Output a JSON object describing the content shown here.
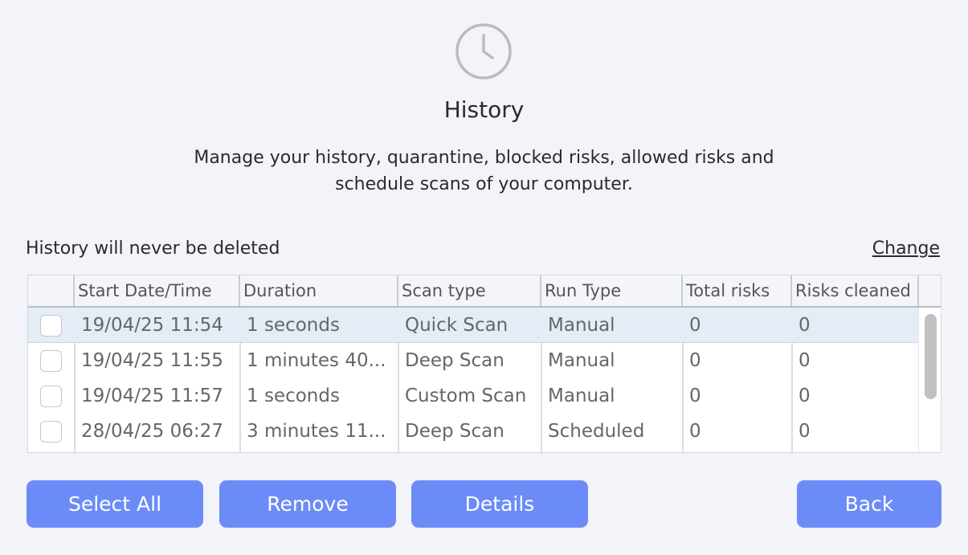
{
  "header": {
    "icon": "clock-icon",
    "title": "History",
    "subtitle_line1": "Manage your history, quarantine, blocked risks, allowed risks and",
    "subtitle_line2": "schedule scans of your computer."
  },
  "retention": {
    "label": "History will never be deleted",
    "change_link": "Change"
  },
  "table": {
    "columns": [
      "Start Date/Time",
      "Duration",
      "Scan type",
      "Run Type",
      "Total risks",
      "Risks cleaned"
    ],
    "rows": [
      {
        "start": "19/04/25 11:54",
        "duration": "1 seconds",
        "scan_type": "Quick Scan",
        "run_type": "Manual",
        "total_risks": "0",
        "risks_cleaned": "0",
        "selected": true
      },
      {
        "start": "19/04/25 11:55",
        "duration": "1 minutes 40...",
        "scan_type": "Deep Scan",
        "run_type": "Manual",
        "total_risks": "0",
        "risks_cleaned": "0",
        "selected": false
      },
      {
        "start": "19/04/25 11:57",
        "duration": "1 seconds",
        "scan_type": "Custom Scan",
        "run_type": "Manual",
        "total_risks": "0",
        "risks_cleaned": "0",
        "selected": false
      },
      {
        "start": "28/04/25 06:27",
        "duration": "3 minutes 11...",
        "scan_type": "Deep Scan",
        "run_type": "Scheduled",
        "total_risks": "0",
        "risks_cleaned": "0",
        "selected": false
      }
    ]
  },
  "buttons": {
    "select_all": "Select All",
    "remove": "Remove",
    "details": "Details",
    "back": "Back"
  },
  "colors": {
    "accent": "#6b8cf7",
    "background": "#f3f4f9",
    "selected_row": "#e4ecf6"
  }
}
